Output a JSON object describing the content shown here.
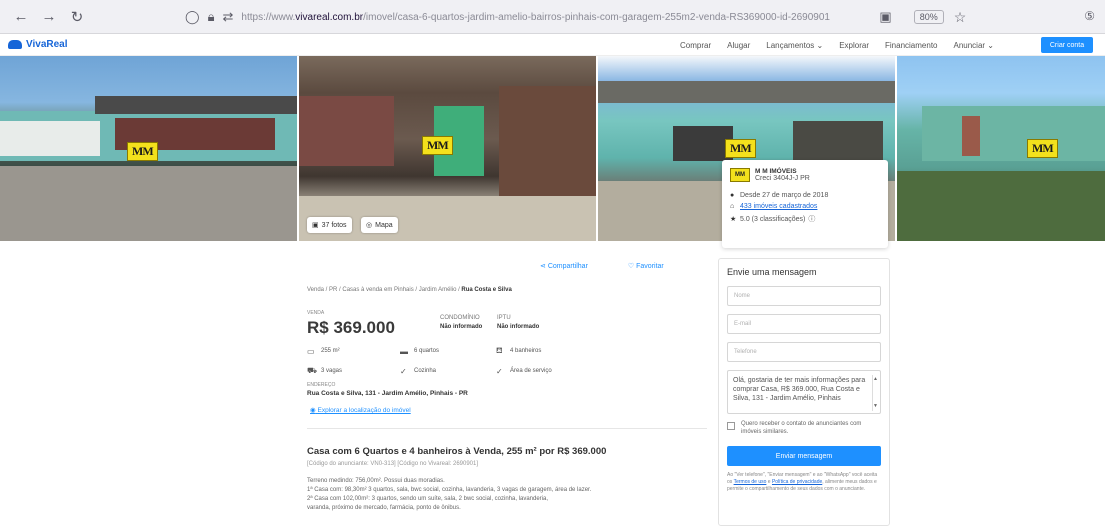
{
  "browser": {
    "url_prefix": "https://www.",
    "url_domain": "vivareal.com.br",
    "url_path": "/imovel/casa-6-quartos-jardim-amelio-bairros-pinhais-com-garagem-255m2-venda-RS369000-id-2690901",
    "zoom": "80%"
  },
  "site": {
    "logo": "VivaReal",
    "nav": [
      "Comprar",
      "Alugar",
      "Lançamentos",
      "Explorar",
      "Financiamento",
      "Anunciar"
    ],
    "cta": "Criar conta"
  },
  "gallery": {
    "watermark": "MM",
    "photos_btn": "37 fotos",
    "map_btn": "Mapa"
  },
  "agent": {
    "name": "M M IMÓVEIS",
    "creci": "Creci 3404J-J PR",
    "since": "Desde 27 de março de 2018",
    "listings": "433 imóveis cadastrados",
    "rating": "5.0 (3 classificações)"
  },
  "actions": {
    "share": "Compartilhar",
    "favorite": "Favoritar"
  },
  "breadcrumb": {
    "path": "Venda / PR / Casas à venda em Pinhais / Jardim Amélio / ",
    "current": "Rua Costa e Silva"
  },
  "listing": {
    "sale_label": "VENDA",
    "price": "R$ 369.000",
    "condo_label": "CONDOMÍNIO",
    "condo_value": "Não informado",
    "iptu_label": "IPTU",
    "iptu_value": "Não informado",
    "features": [
      {
        "icon": "▭",
        "label": "255 m²"
      },
      {
        "icon": "▬",
        "label": "6 quartos"
      },
      {
        "icon": "⛾",
        "label": "4 banheiros"
      },
      {
        "icon": "⛟",
        "label": "3 vagas"
      },
      {
        "icon": "✓",
        "label": "Cozinha"
      },
      {
        "icon": "✓",
        "label": "Área de serviço"
      }
    ],
    "address_label": "ENDEREÇO",
    "address": "Rua Costa e Silva, 131 - Jardim Amélio, Pinhais - PR",
    "explore": "Explorar a localização do imóvel",
    "title": "Casa com 6 Quartos e 4 banheiros à Venda, 255 m² por R$ 369.000",
    "code_line": "[Código do anunciante: VN0-313] [Código no Vivareal: 2690901]",
    "description": [
      "Terreno medindo: 756,00m². Possui duas moradias.",
      "1ª Casa com: 98,30m² 3 quartos, sala, bwc social, cozinha, lavanderia, 3 vagas de garagem, área de lazer.",
      "2ª Casa com 102,00m²: 3 quartos, sendo um suíte, sala, 2 bwc social, cozinha, lavanderia,",
      "varanda, próximo de mercado, farmácia, ponto de ônibus."
    ]
  },
  "contact": {
    "title": "Envie uma mensagem",
    "name_placeholder": "Nome",
    "email_placeholder": "E-mail",
    "phone_placeholder": "Telefone",
    "message": "Olá, gostaria de ter mais informações para comprar Casa, R$ 369.000, Rua Costa e Silva, 131 - Jardim Amélio, Pinhais",
    "consent": "Quero receber o contato de anunciantes com imóveis similares.",
    "send": "Enviar mensagem",
    "legal_prefix": "Ao \"Ver telefone\", \"Enviar mensagem\" e ao \"WhatsApp\" você aceita os ",
    "terms": "Termos de uso",
    "legal_and": " e ",
    "privacy": "Política de privacidade",
    "legal_suffix": ", alimente meus dados e permite o compartilhamento de seus dados com o anunciante."
  },
  "colors": {
    "brand": "#1665d8",
    "accent": "#1e90ff",
    "watermark": "#f3e11c"
  }
}
